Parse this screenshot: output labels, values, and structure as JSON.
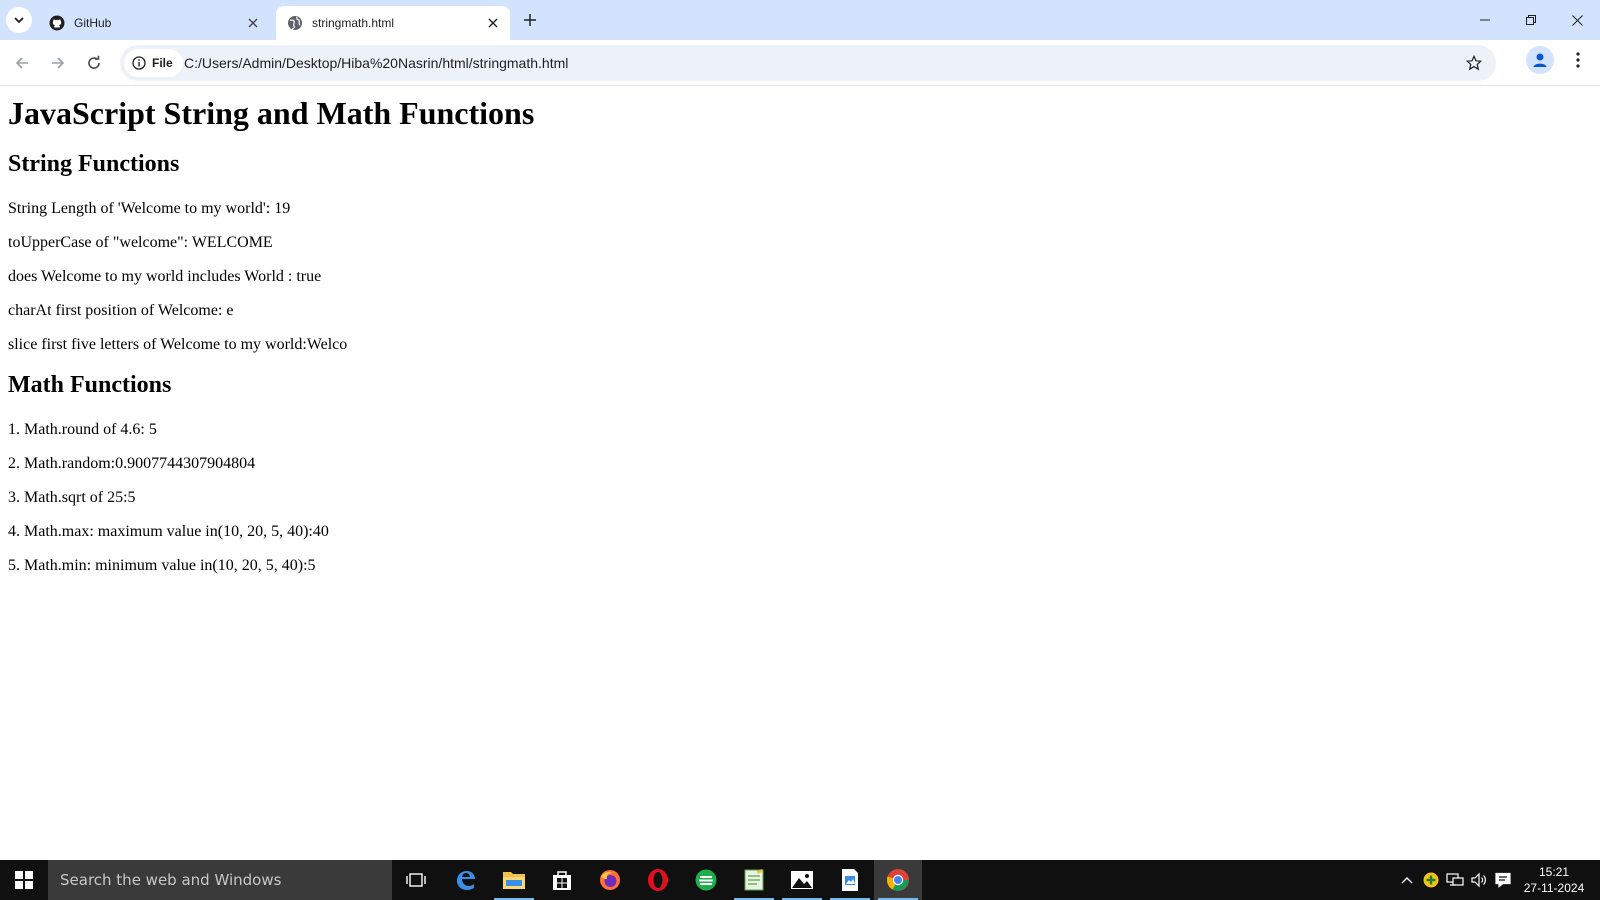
{
  "browser": {
    "tabs": [
      {
        "title": "GitHub",
        "icon": "github-icon",
        "active": false
      },
      {
        "title": "stringmath.html",
        "icon": "globe-icon",
        "active": true
      }
    ],
    "address_bar": {
      "chip_label": "File",
      "url": "C:/Users/Admin/Desktop/Hiba%20Nasrin/html/stringmath.html"
    },
    "colors": {
      "tabstrip": "#d3e3fd",
      "omnibox": "#edf2fa"
    }
  },
  "page": {
    "title": "JavaScript String and Math Functions",
    "string_section": {
      "heading": "String Functions",
      "lines": [
        "String Length of 'Welcome to my world': 19",
        "toUpperCase of \"welcome\": WELCOME",
        "does Welcome to my world includes World : true",
        "charAt first position of Welcome: e",
        "slice first five letters of Welcome to my world:Welco"
      ]
    },
    "math_section": {
      "heading": "Math Functions",
      "lines": [
        "1. Math.round of 4.6: 5",
        "2. Math.random:0.9007744307904804",
        "3. Math.sqrt of 25:5",
        "4. Math.max: maximum value in(10, 20, 5, 40):40",
        "5. Math.min: minimum value in(10, 20, 5, 40):5"
      ]
    }
  },
  "taskbar": {
    "search_placeholder": "Search the web and Windows",
    "apps": [
      "task-view-icon",
      "edge-icon",
      "file-explorer-icon",
      "store-icon",
      "firefox-icon",
      "opera-icon",
      "green-app-icon",
      "notepad-icon",
      "photos-icon",
      "paint-icon",
      "chrome-icon"
    ],
    "clock": {
      "time": "15:21",
      "date": "27-11-2024"
    }
  }
}
